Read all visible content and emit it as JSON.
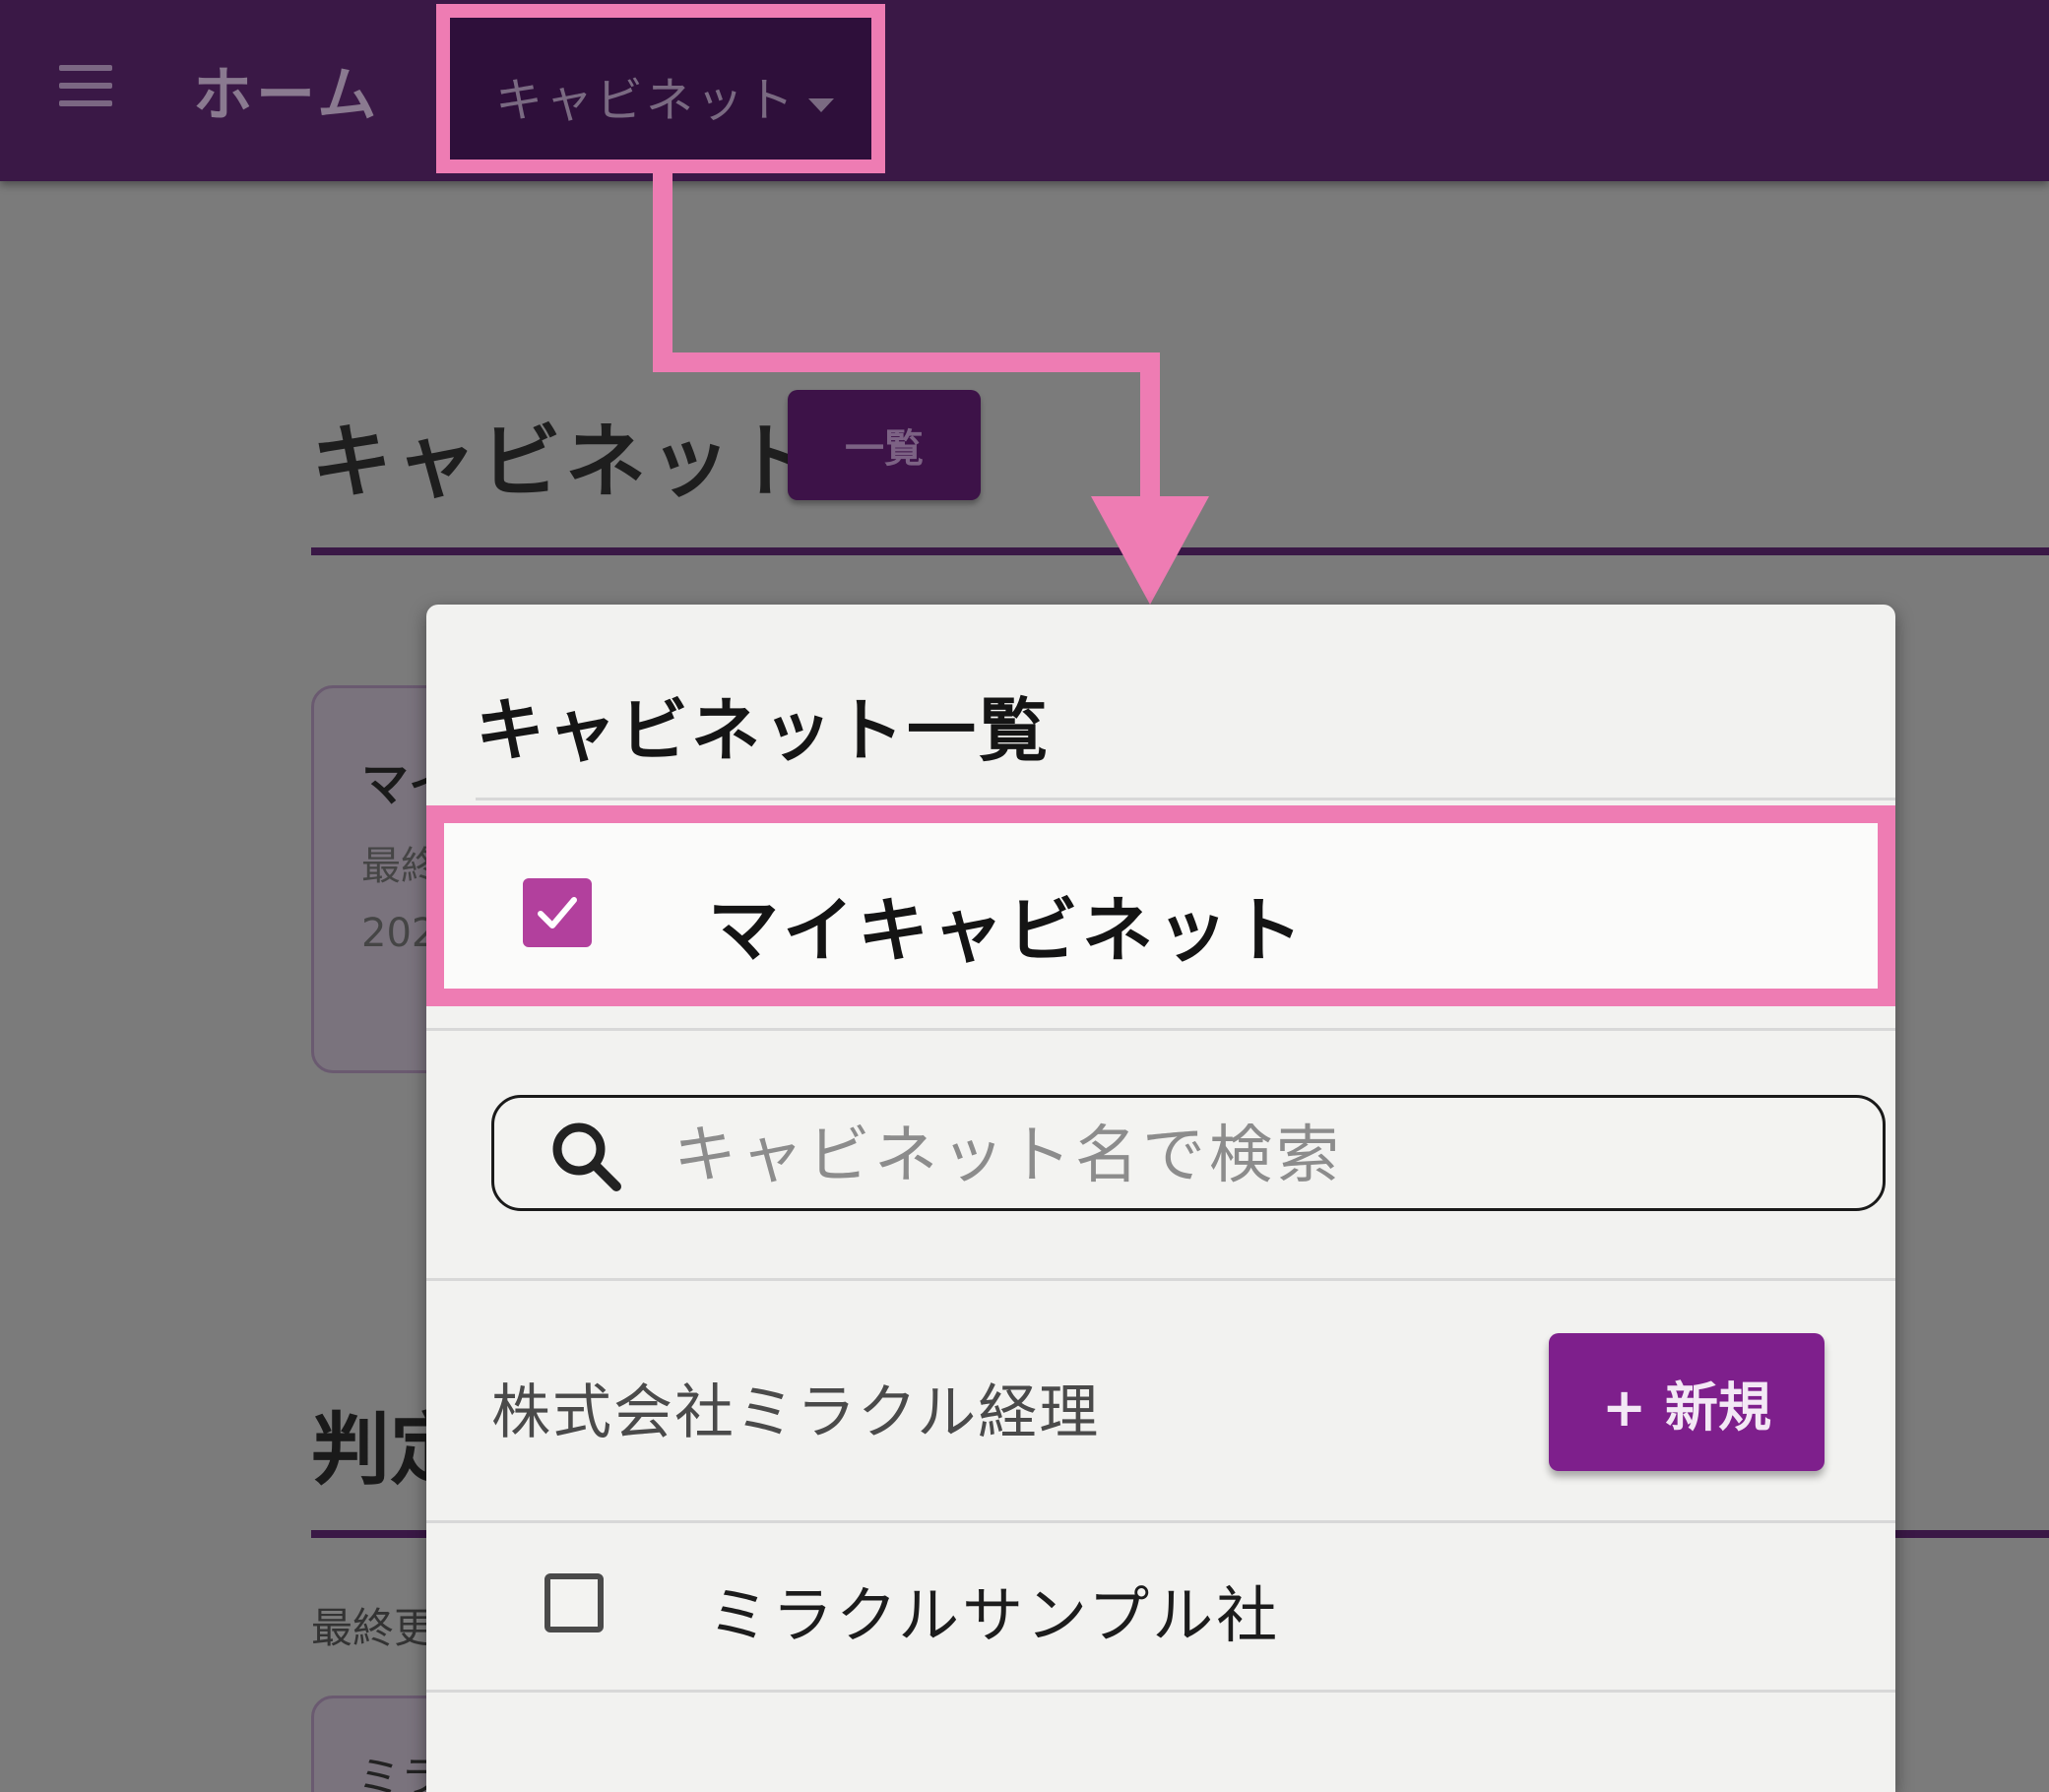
{
  "appbar": {
    "title": "ホーム",
    "cabinet_dropdown_label": "キャビネット"
  },
  "page": {
    "section_title": "キャビネット",
    "list_button_label": "一覧",
    "bg_card_title": "マイ",
    "bg_card_line1": "最終",
    "bg_card_line2": "202",
    "judge_heading": "判定",
    "last_updated_label": "最終更",
    "bg_card2_title": "ミラ"
  },
  "panel": {
    "title": "キャビネット一覧",
    "my_cabinet": {
      "label": "マイキャビネット",
      "checked": true
    },
    "search": {
      "placeholder": "キャビネット名で検索",
      "value": ""
    },
    "company": {
      "name": "株式会社ミラクル経理",
      "new_button_label": "+ 新規"
    },
    "cabinets": [
      {
        "label": "ミラクルサンプル社",
        "checked": false
      }
    ]
  },
  "colors": {
    "appbar": "#3a1846",
    "accent": "#7e1f8c",
    "checkbox_checked": "#b2409d",
    "highlight": "#ee7cb3"
  },
  "icons": [
    "menu-icon",
    "chevron-down-icon",
    "check-icon",
    "search-icon"
  ]
}
